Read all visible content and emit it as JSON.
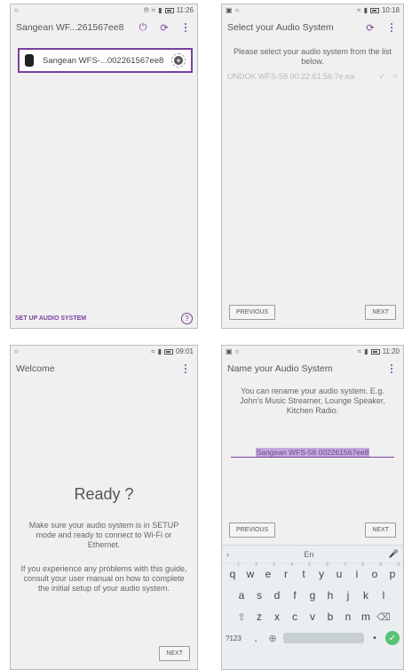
{
  "screens": [
    {
      "status_time": "11:26",
      "title": "Sangean WF...261567ee8 ▲",
      "device_name": "Sangean WFS-...002261567ee8",
      "setup_link": "SET UP AUDIO SYSTEM",
      "help_glyph": "?"
    },
    {
      "status_time": "10:18",
      "title": "Select your Audio System",
      "instruction": "Please select your audio system from the list below.",
      "list_item": "UNDOK WFS-58 00:22:61:56:7e:ea",
      "previous_label": "PREVIOUS",
      "next_label": "NEXT"
    },
    {
      "status_time": "09:01",
      "title": "Welcome",
      "ready": "Ready ?",
      "para1": "Make sure your audio system is in SETUP mode and ready to connect to Wi-Fi or Ethernet.",
      "para2": "If you experience any problems with this guide, consult your user manual on how to complete the initial setup of your audio system.",
      "next_label": "NEXT"
    },
    {
      "status_time": "11:20",
      "title": "Name your Audio System",
      "instruction": "You can rename your audio system. E.g. John's Music Streamer, Lounge Speaker, Kitchen Radio.",
      "field_value": "Sangean WFS-58 002261567ee8",
      "previous_label": "PREVIOUS",
      "next_label": "NEXT",
      "keyboard": {
        "language": "En",
        "row1": [
          "q",
          "w",
          "e",
          "r",
          "t",
          "y",
          "u",
          "i",
          "o",
          "p"
        ],
        "row1_hints": [
          "1",
          "2",
          "3",
          "4",
          "5",
          "6",
          "7",
          "8",
          "9",
          "0"
        ],
        "row2": [
          "a",
          "s",
          "d",
          "f",
          "g",
          "h",
          "j",
          "k",
          "l"
        ],
        "row3": [
          "z",
          "x",
          "c",
          "v",
          "b",
          "n",
          "m"
        ],
        "sym_label": "?123"
      }
    }
  ],
  "colors": {
    "accent": "#7b3f9e",
    "enter": "#57c278"
  }
}
